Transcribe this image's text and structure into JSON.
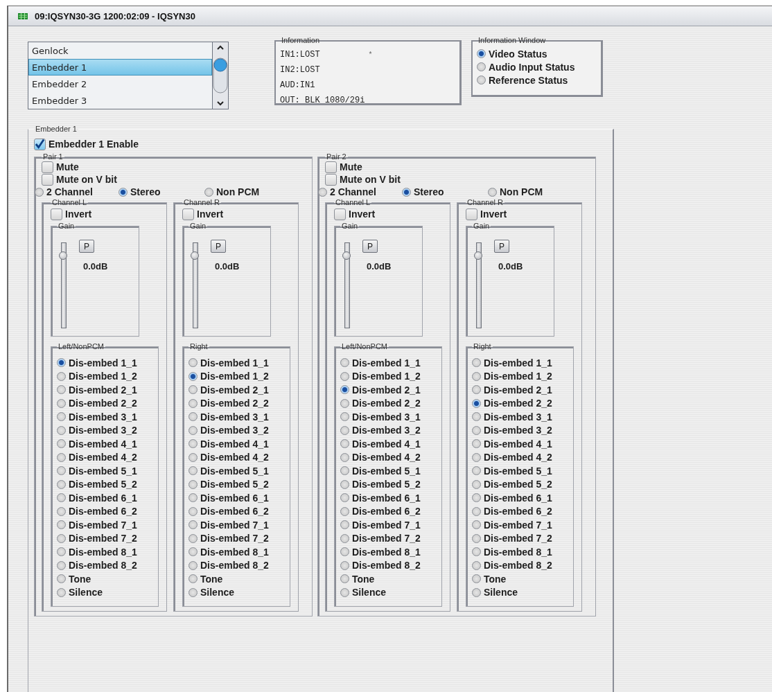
{
  "window": {
    "title": "09:IQSYN30-3G  1200:02:09  - IQSYN30"
  },
  "module_list": {
    "items": [
      {
        "label": "Genlock",
        "selected": false
      },
      {
        "label": "Embedder 1",
        "selected": true
      },
      {
        "label": "Embedder 2",
        "selected": false
      },
      {
        "label": "Embedder 3",
        "selected": false
      }
    ]
  },
  "information": {
    "title": "Information",
    "lines": [
      {
        "text": "IN1:LOST",
        "note": "*"
      },
      {
        "text": "IN2:LOST"
      },
      {
        "text": "AUD:IN1"
      },
      {
        "text": "OUT: BLK 1080/29i"
      }
    ]
  },
  "information_window": {
    "title": "Information Window",
    "options": [
      {
        "label": "Video Status",
        "selected": true
      },
      {
        "label": "Audio Input Status",
        "selected": false
      },
      {
        "label": "Reference Status",
        "selected": false
      }
    ]
  },
  "embedder": {
    "title": "Embedder 1",
    "enable": {
      "label": "Embedder 1 Enable",
      "checked": true
    },
    "pairs": [
      {
        "title": "Pair 1",
        "mute": {
          "label": "Mute",
          "checked": false
        },
        "mute_v_bit": {
          "label": "Mute on V bit",
          "checked": false
        },
        "modes": [
          {
            "label": "2 Channel",
            "selected": false
          },
          {
            "label": "Stereo",
            "selected": true
          },
          {
            "label": "Non PCM",
            "selected": false
          }
        ],
        "channels": [
          {
            "title": "Channel L",
            "invert": {
              "label": "Invert",
              "checked": false
            },
            "gain": {
              "title": "Gain",
              "button": "P",
              "level": 0.85,
              "reading": "0.0dB"
            },
            "source": {
              "title": "Left/NonPCM",
              "options": [
                {
                  "label": "Dis-embed 1_1",
                  "selected": true
                },
                {
                  "label": "Dis-embed 1_2",
                  "selected": false
                },
                {
                  "label": "Dis-embed 2_1",
                  "selected": false
                },
                {
                  "label": "Dis-embed 2_2",
                  "selected": false
                },
                {
                  "label": "Dis-embed 3_1",
                  "selected": false
                },
                {
                  "label": "Dis-embed 3_2",
                  "selected": false
                },
                {
                  "label": "Dis-embed 4_1",
                  "selected": false
                },
                {
                  "label": "Dis-embed 4_2",
                  "selected": false
                },
                {
                  "label": "Dis-embed 5_1",
                  "selected": false
                },
                {
                  "label": "Dis-embed 5_2",
                  "selected": false
                },
                {
                  "label": "Dis-embed 6_1",
                  "selected": false
                },
                {
                  "label": "Dis-embed 6_2",
                  "selected": false
                },
                {
                  "label": "Dis-embed 7_1",
                  "selected": false
                },
                {
                  "label": "Dis-embed 7_2",
                  "selected": false
                },
                {
                  "label": "Dis-embed 8_1",
                  "selected": false
                },
                {
                  "label": "Dis-embed 8_2",
                  "selected": false
                },
                {
                  "label": "Tone",
                  "selected": false
                },
                {
                  "label": "Silence",
                  "selected": false
                }
              ]
            }
          },
          {
            "title": "Channel R",
            "invert": {
              "label": "Invert",
              "checked": false
            },
            "gain": {
              "title": "Gain",
              "button": "P",
              "level": 0.85,
              "reading": "0.0dB"
            },
            "source": {
              "title": "Right",
              "options": [
                {
                  "label": "Dis-embed 1_1",
                  "selected": false
                },
                {
                  "label": "Dis-embed 1_2",
                  "selected": true
                },
                {
                  "label": "Dis-embed 2_1",
                  "selected": false
                },
                {
                  "label": "Dis-embed 2_2",
                  "selected": false
                },
                {
                  "label": "Dis-embed 3_1",
                  "selected": false
                },
                {
                  "label": "Dis-embed 3_2",
                  "selected": false
                },
                {
                  "label": "Dis-embed 4_1",
                  "selected": false
                },
                {
                  "label": "Dis-embed 4_2",
                  "selected": false
                },
                {
                  "label": "Dis-embed 5_1",
                  "selected": false
                },
                {
                  "label": "Dis-embed 5_2",
                  "selected": false
                },
                {
                  "label": "Dis-embed 6_1",
                  "selected": false
                },
                {
                  "label": "Dis-embed 6_2",
                  "selected": false
                },
                {
                  "label": "Dis-embed 7_1",
                  "selected": false
                },
                {
                  "label": "Dis-embed 7_2",
                  "selected": false
                },
                {
                  "label": "Dis-embed 8_1",
                  "selected": false
                },
                {
                  "label": "Dis-embed 8_2",
                  "selected": false
                },
                {
                  "label": "Tone",
                  "selected": false
                },
                {
                  "label": "Silence",
                  "selected": false
                }
              ]
            }
          }
        ]
      },
      {
        "title": "Pair 2",
        "mute": {
          "label": "Mute",
          "checked": false
        },
        "mute_v_bit": {
          "label": "Mute on V bit",
          "checked": false
        },
        "modes": [
          {
            "label": "2 Channel",
            "selected": false
          },
          {
            "label": "Stereo",
            "selected": true
          },
          {
            "label": "Non PCM",
            "selected": false
          }
        ],
        "channels": [
          {
            "title": "Channel L",
            "invert": {
              "label": "Invert",
              "checked": false
            },
            "gain": {
              "title": "Gain",
              "button": "P",
              "level": 0.85,
              "reading": "0.0dB"
            },
            "source": {
              "title": "Left/NonPCM",
              "options": [
                {
                  "label": "Dis-embed 1_1",
                  "selected": false
                },
                {
                  "label": "Dis-embed 1_2",
                  "selected": false
                },
                {
                  "label": "Dis-embed 2_1",
                  "selected": true
                },
                {
                  "label": "Dis-embed 2_2",
                  "selected": false
                },
                {
                  "label": "Dis-embed 3_1",
                  "selected": false
                },
                {
                  "label": "Dis-embed 3_2",
                  "selected": false
                },
                {
                  "label": "Dis-embed 4_1",
                  "selected": false
                },
                {
                  "label": "Dis-embed 4_2",
                  "selected": false
                },
                {
                  "label": "Dis-embed 5_1",
                  "selected": false
                },
                {
                  "label": "Dis-embed 5_2",
                  "selected": false
                },
                {
                  "label": "Dis-embed 6_1",
                  "selected": false
                },
                {
                  "label": "Dis-embed 6_2",
                  "selected": false
                },
                {
                  "label": "Dis-embed 7_1",
                  "selected": false
                },
                {
                  "label": "Dis-embed 7_2",
                  "selected": false
                },
                {
                  "label": "Dis-embed 8_1",
                  "selected": false
                },
                {
                  "label": "Dis-embed 8_2",
                  "selected": false
                },
                {
                  "label": "Tone",
                  "selected": false
                },
                {
                  "label": "Silence",
                  "selected": false
                }
              ]
            }
          },
          {
            "title": "Channel R",
            "invert": {
              "label": "Invert",
              "checked": false
            },
            "gain": {
              "title": "Gain",
              "button": "P",
              "level": 0.85,
              "reading": "0.0dB"
            },
            "source": {
              "title": "Right",
              "options": [
                {
                  "label": "Dis-embed 1_1",
                  "selected": false
                },
                {
                  "label": "Dis-embed 1_2",
                  "selected": false
                },
                {
                  "label": "Dis-embed 2_1",
                  "selected": false
                },
                {
                  "label": "Dis-embed 2_2",
                  "selected": true
                },
                {
                  "label": "Dis-embed 3_1",
                  "selected": false
                },
                {
                  "label": "Dis-embed 3_2",
                  "selected": false
                },
                {
                  "label": "Dis-embed 4_1",
                  "selected": false
                },
                {
                  "label": "Dis-embed 4_2",
                  "selected": false
                },
                {
                  "label": "Dis-embed 5_1",
                  "selected": false
                },
                {
                  "label": "Dis-embed 5_2",
                  "selected": false
                },
                {
                  "label": "Dis-embed 6_1",
                  "selected": false
                },
                {
                  "label": "Dis-embed 6_2",
                  "selected": false
                },
                {
                  "label": "Dis-embed 7_1",
                  "selected": false
                },
                {
                  "label": "Dis-embed 7_2",
                  "selected": false
                },
                {
                  "label": "Dis-embed 8_1",
                  "selected": false
                },
                {
                  "label": "Dis-embed 8_2",
                  "selected": false
                },
                {
                  "label": "Tone",
                  "selected": false
                },
                {
                  "label": "Silence",
                  "selected": false
                }
              ]
            }
          }
        ]
      }
    ]
  }
}
